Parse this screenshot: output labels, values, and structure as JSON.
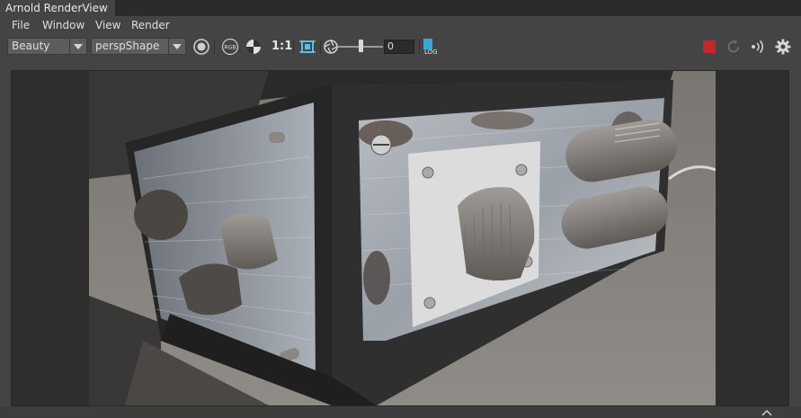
{
  "window": {
    "tab_title": "Arnold RenderView"
  },
  "menu": {
    "items": [
      "File",
      "Window",
      "View",
      "Render"
    ]
  },
  "toolbar": {
    "aov_dropdown": "Beauty",
    "camera_dropdown": "perspShape",
    "ratio_label": "1:1",
    "rgb_label": "RGB",
    "exposure_value": "0",
    "exposure_level": 0.5,
    "log_label": "LOG"
  },
  "colors": {
    "stop_render": "#c0282a",
    "log_icon": "#3aa6d8",
    "region_icon": "#4fc3e8",
    "panel": "#444444",
    "viewport": "#2e2e2e"
  },
  "icons": [
    "record-icon",
    "rgb-channel-icon",
    "alpha-contrast-icon",
    "crop-region-icon",
    "aperture-exposure-icon",
    "log-icon",
    "stop-render-icon",
    "refresh-icon",
    "ipr-broadcast-icon",
    "settings-gear-icon"
  ]
}
